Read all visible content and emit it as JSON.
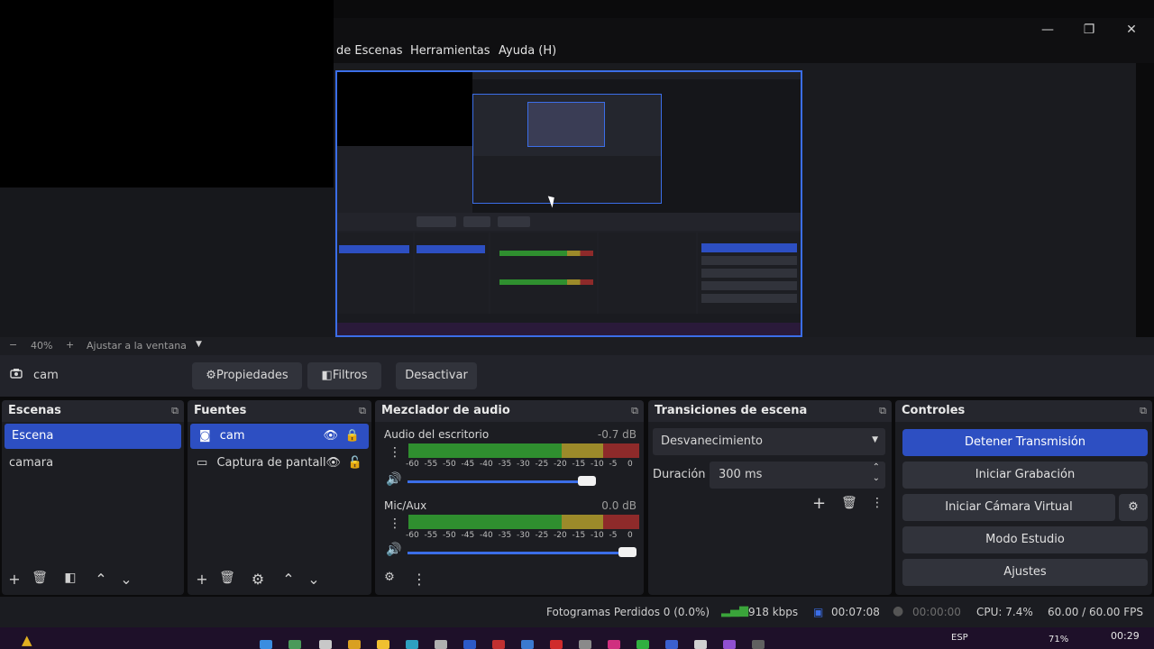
{
  "menu": {
    "items": [
      "de Escenas",
      "Herramientas",
      "Ayuda (H)"
    ]
  },
  "window_controls": {
    "minimize": "—",
    "restore": "❐",
    "close": "✕"
  },
  "zoom": {
    "minus": "−",
    "level": "40%",
    "plus": "+",
    "fit_label": "Ajustar a la ventana"
  },
  "source_toolbar": {
    "source_name": "cam",
    "properties_label": "Propiedades",
    "filters_label": "Filtros",
    "deactivate_label": "Desactivar"
  },
  "scenes": {
    "title": "Escenas",
    "items": [
      "Escena",
      "camara"
    ]
  },
  "sources": {
    "title": "Fuentes",
    "items": [
      "cam",
      "Captura de pantall"
    ]
  },
  "mixer": {
    "title": "Mezclador de audio",
    "channels": [
      {
        "name": "Audio del escritorio",
        "db": "-0.7 dB",
        "volume": 0.82
      },
      {
        "name": "Mic/Aux",
        "db": "0.0 dB",
        "volume": 1.0
      }
    ],
    "ticks": [
      "-60",
      "-55",
      "-50",
      "-45",
      "-40",
      "-35",
      "-30",
      "-25",
      "-20",
      "-15",
      "-10",
      "-5",
      "0"
    ]
  },
  "transitions": {
    "title": "Transiciones de escena",
    "selected": "Desvanecimiento",
    "duration_label": "Duración",
    "duration_value": "300 ms"
  },
  "controls": {
    "title": "Controles",
    "stop_stream": "Detener Transmisión",
    "start_record": "Iniciar Grabación",
    "virtual_cam": "Iniciar Cámara Virtual",
    "studio_mode": "Modo Estudio",
    "settings": "Ajustes"
  },
  "status": {
    "dropped_frames": "Fotogramas Perdidos 0 (0.0%)",
    "bitrate": "918 kbps",
    "stream_time": "00:07:08",
    "record_time": "00:00:00",
    "cpu": "CPU: 7.4%",
    "fps": "60.00 / 60.00 FPS"
  },
  "taskbar": {
    "lang": "ESP",
    "battery": "71%",
    "time": "00:29"
  },
  "colors": {
    "accent": "#2d4fc2",
    "meter_green": "#2f8f2f",
    "meter_yellow": "#9c8a2a",
    "meter_red": "#8e2a2a"
  }
}
